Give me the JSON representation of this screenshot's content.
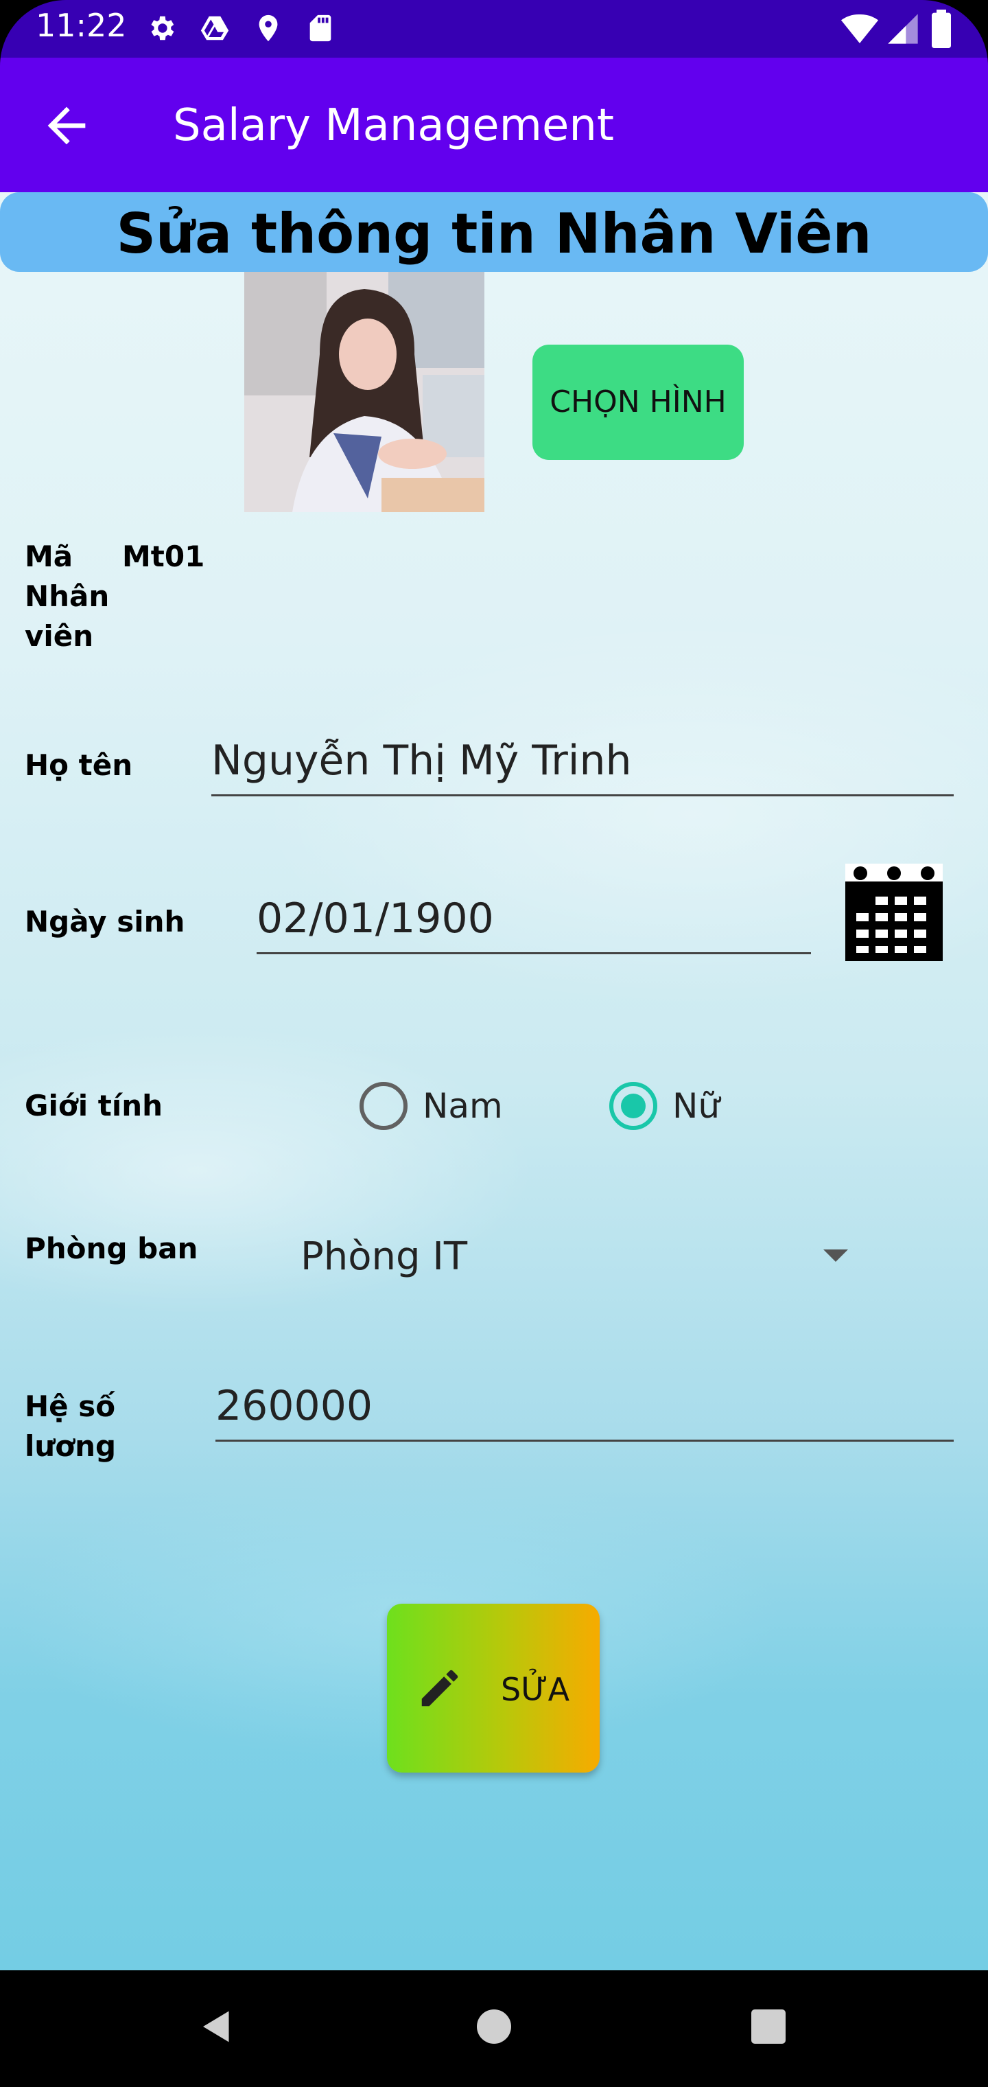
{
  "status_bar": {
    "time": "11:22",
    "icons": [
      "gear-icon",
      "drive-icon",
      "location-icon",
      "sd-card-icon",
      "wifi-icon",
      "signal-icon",
      "battery-icon"
    ]
  },
  "app_bar": {
    "title": "Salary Management",
    "back_icon": "arrow-left-icon"
  },
  "form": {
    "heading": "Sửa thông tin Nhân Viên",
    "choose_image_label": "CHỌN HÌNH",
    "employee_id": {
      "label": "Mã\nNhân\nviên",
      "value": "Mt01"
    },
    "full_name": {
      "label": "Họ tên",
      "value": "Nguyễn Thị Mỹ Trinh"
    },
    "birth_date": {
      "label": "Ngày sinh",
      "value": "02/01/1900"
    },
    "gender": {
      "label": "Giới tính",
      "options": [
        {
          "label": "Nam",
          "checked": false
        },
        {
          "label": "Nữ",
          "checked": true
        }
      ]
    },
    "department": {
      "label": "Phòng ban",
      "selected": "Phòng IT"
    },
    "salary_coefficient": {
      "label": "Hệ số\nlương",
      "value": "260000"
    },
    "submit_label": "SỬA"
  },
  "colors": {
    "status_bar": "#3700b3",
    "app_bar": "#6200ee",
    "banner": "#69b9f3",
    "choose_button": "#3ddc84",
    "radio_checked": "#19c7a9"
  }
}
